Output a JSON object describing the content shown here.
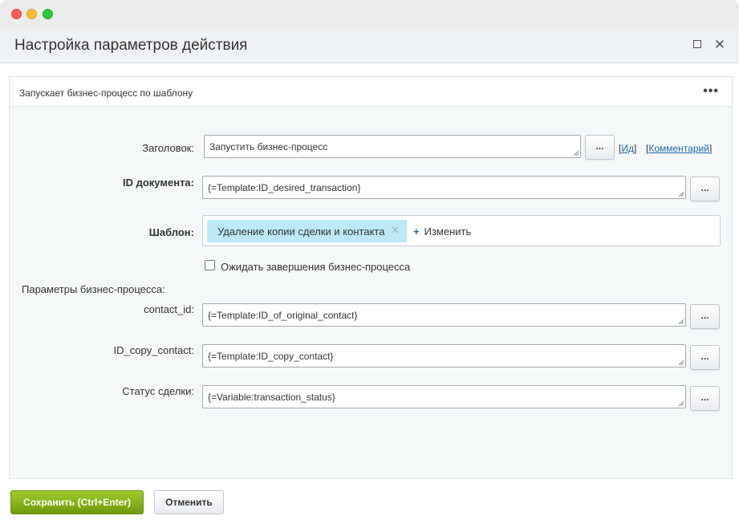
{
  "dialog": {
    "title": "Настройка параметров действия"
  },
  "panel": {
    "description": "Запускает бизнес-процесс по шаблону",
    "more_label": "•••"
  },
  "form": {
    "title_label": "Заголовок:",
    "title_value": "Запустить бизнес-процесс",
    "id_link": "Ид",
    "comment_link": "Комментарий",
    "doc_id_label": "ID документа:",
    "doc_id_value": "{=Template:ID_desired_transaction}",
    "template_label": "Шаблон:",
    "template_chip": "Удаление копии сделки и контакта",
    "template_change": "Изменить",
    "wait_label": "Ожидать завершения бизнес-процесса",
    "wait_checked": false,
    "params_label": "Параметры бизнес-процесса:",
    "dots_label": "...",
    "params": [
      {
        "label": "contact_id:",
        "value": "{=Template:ID_of_original_contact}"
      },
      {
        "label": "ID_copy_contact:",
        "value": "{=Template:ID_copy_contact}"
      },
      {
        "label": "Статус сделки:",
        "value": "{=Variable:transaction_status}"
      }
    ]
  },
  "footer": {
    "save_label": "Сохранить (Ctrl+Enter)",
    "cancel_label": "Отменить"
  },
  "colors": {
    "save_button": "#7fab15",
    "link": "#2067b0",
    "chip": "#bde8f5"
  }
}
